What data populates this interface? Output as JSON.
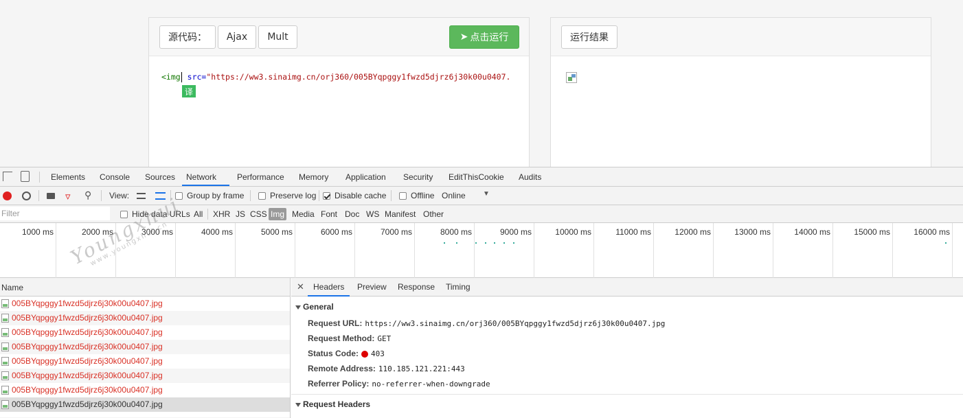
{
  "editor": {
    "source_label": "源代码：",
    "ajax_label": "Ajax",
    "mult_label": "Mult",
    "run_label": "点击运行",
    "code_tag": "<img",
    "code_attr": "src=",
    "code_value": "\"https://ww3.sinaimg.cn/orj360/005BYqpggy1fwzd5djrz6j30k00u0407.",
    "translate_badge": "译"
  },
  "result": {
    "result_label": "运行结果"
  },
  "devtools": {
    "tabs": [
      "Elements",
      "Console",
      "Sources",
      "Network",
      "Performance",
      "Memory",
      "Application",
      "Security",
      "EditThisCookie",
      "Audits"
    ],
    "active_tab": "Network",
    "toolbar": {
      "view_label": "View:",
      "group_by_frame": "Group by frame",
      "preserve_log": "Preserve log",
      "disable_cache": "Disable cache",
      "offline": "Offline",
      "throttle": "Online"
    },
    "filter": {
      "placeholder": "Filter",
      "hide_data_urls": "Hide data URLs",
      "types": [
        "All",
        "XHR",
        "JS",
        "CSS",
        "Img",
        "Media",
        "Font",
        "Doc",
        "WS",
        "Manifest",
        "Other"
      ],
      "selected_type": "Img"
    },
    "timeline_ticks": [
      "1000 ms",
      "2000 ms",
      "3000 ms",
      "4000 ms",
      "5000 ms",
      "6000 ms",
      "7000 ms",
      "8000 ms",
      "9000 ms",
      "10000 ms",
      "11000 ms",
      "12000 ms",
      "13000 ms",
      "14000 ms",
      "15000 ms",
      "16000 ms"
    ],
    "list": {
      "name_header": "Name",
      "rows": [
        "005BYqpggy1fwzd5djrz6j30k00u0407.jpg",
        "005BYqpggy1fwzd5djrz6j30k00u0407.jpg",
        "005BYqpggy1fwzd5djrz6j30k00u0407.jpg",
        "005BYqpggy1fwzd5djrz6j30k00u0407.jpg",
        "005BYqpggy1fwzd5djrz6j30k00u0407.jpg",
        "005BYqpggy1fwzd5djrz6j30k00u0407.jpg",
        "005BYqpggy1fwzd5djrz6j30k00u0407.jpg",
        "005BYqpggy1fwzd5djrz6j30k00u0407.jpg"
      ]
    },
    "detail_tabs": [
      "Headers",
      "Preview",
      "Response",
      "Timing"
    ],
    "active_detail_tab": "Headers",
    "general": {
      "title": "General",
      "request_url_key": "Request URL:",
      "request_url": "https://ww3.sinaimg.cn/orj360/005BYqpggy1fwzd5djrz6j30k00u0407.jpg",
      "request_method_key": "Request Method:",
      "request_method": "GET",
      "status_code_key": "Status Code:",
      "status_code": "403",
      "remote_address_key": "Remote Address:",
      "remote_address": "110.185.121.221:443",
      "referrer_policy_key": "Referrer Policy:",
      "referrer_policy": "no-referrer-when-downgrade"
    },
    "request_headers_title": "Request Headers"
  },
  "watermark": {
    "line1": "Youngxhui",
    "line2": "www.youngxhui.cn"
  },
  "colors": {
    "run_button": "#5cb85c",
    "status_error": "#dd0000",
    "error_row_text": "#d93025",
    "active_tab_underline": "#1a73e8"
  }
}
